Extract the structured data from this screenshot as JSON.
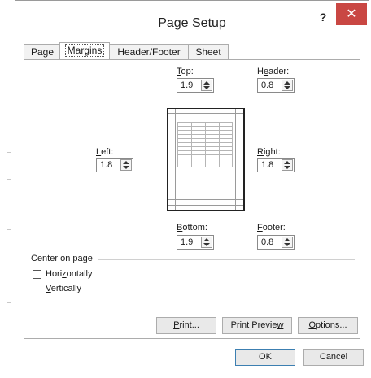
{
  "dialog": {
    "title": "Page Setup",
    "help_label": "?",
    "close_label": "✕"
  },
  "tabs": [
    {
      "label": "Page"
    },
    {
      "label": "Margins"
    },
    {
      "label": "Header/Footer"
    },
    {
      "label": "Sheet"
    }
  ],
  "margins": {
    "top": {
      "label_underlined": "T",
      "label_rest": "op:",
      "value": "1.9"
    },
    "header": {
      "label_pre": "H",
      "label_underlined": "e",
      "label_rest": "ader:",
      "value": "0.8"
    },
    "left": {
      "label_underlined": "L",
      "label_rest": "eft:",
      "value": "1.8"
    },
    "right": {
      "label_underlined": "R",
      "label_rest": "ight:",
      "value": "1.8"
    },
    "bottom": {
      "label_underlined": "B",
      "label_rest": "ottom:",
      "value": "1.9"
    },
    "footer": {
      "label_underlined": "F",
      "label_rest": "ooter:",
      "value": "0.8"
    }
  },
  "center_on_page": {
    "title": "Center on page",
    "horizontally": {
      "pre": "Hori",
      "underlined": "z",
      "rest": "ontally",
      "checked": false
    },
    "vertically": {
      "underlined": "V",
      "rest": "ertically",
      "checked": false
    }
  },
  "buttons": {
    "print": {
      "underlined": "P",
      "rest": "rint..."
    },
    "print_preview": {
      "pre": "Print Previe",
      "underlined": "w",
      "rest": ""
    },
    "options": {
      "underlined": "O",
      "rest": "ptions..."
    },
    "ok": "OK",
    "cancel": "Cancel"
  },
  "colors": {
    "close_button": "#c94743",
    "ok_border": "#3c7fb1"
  }
}
